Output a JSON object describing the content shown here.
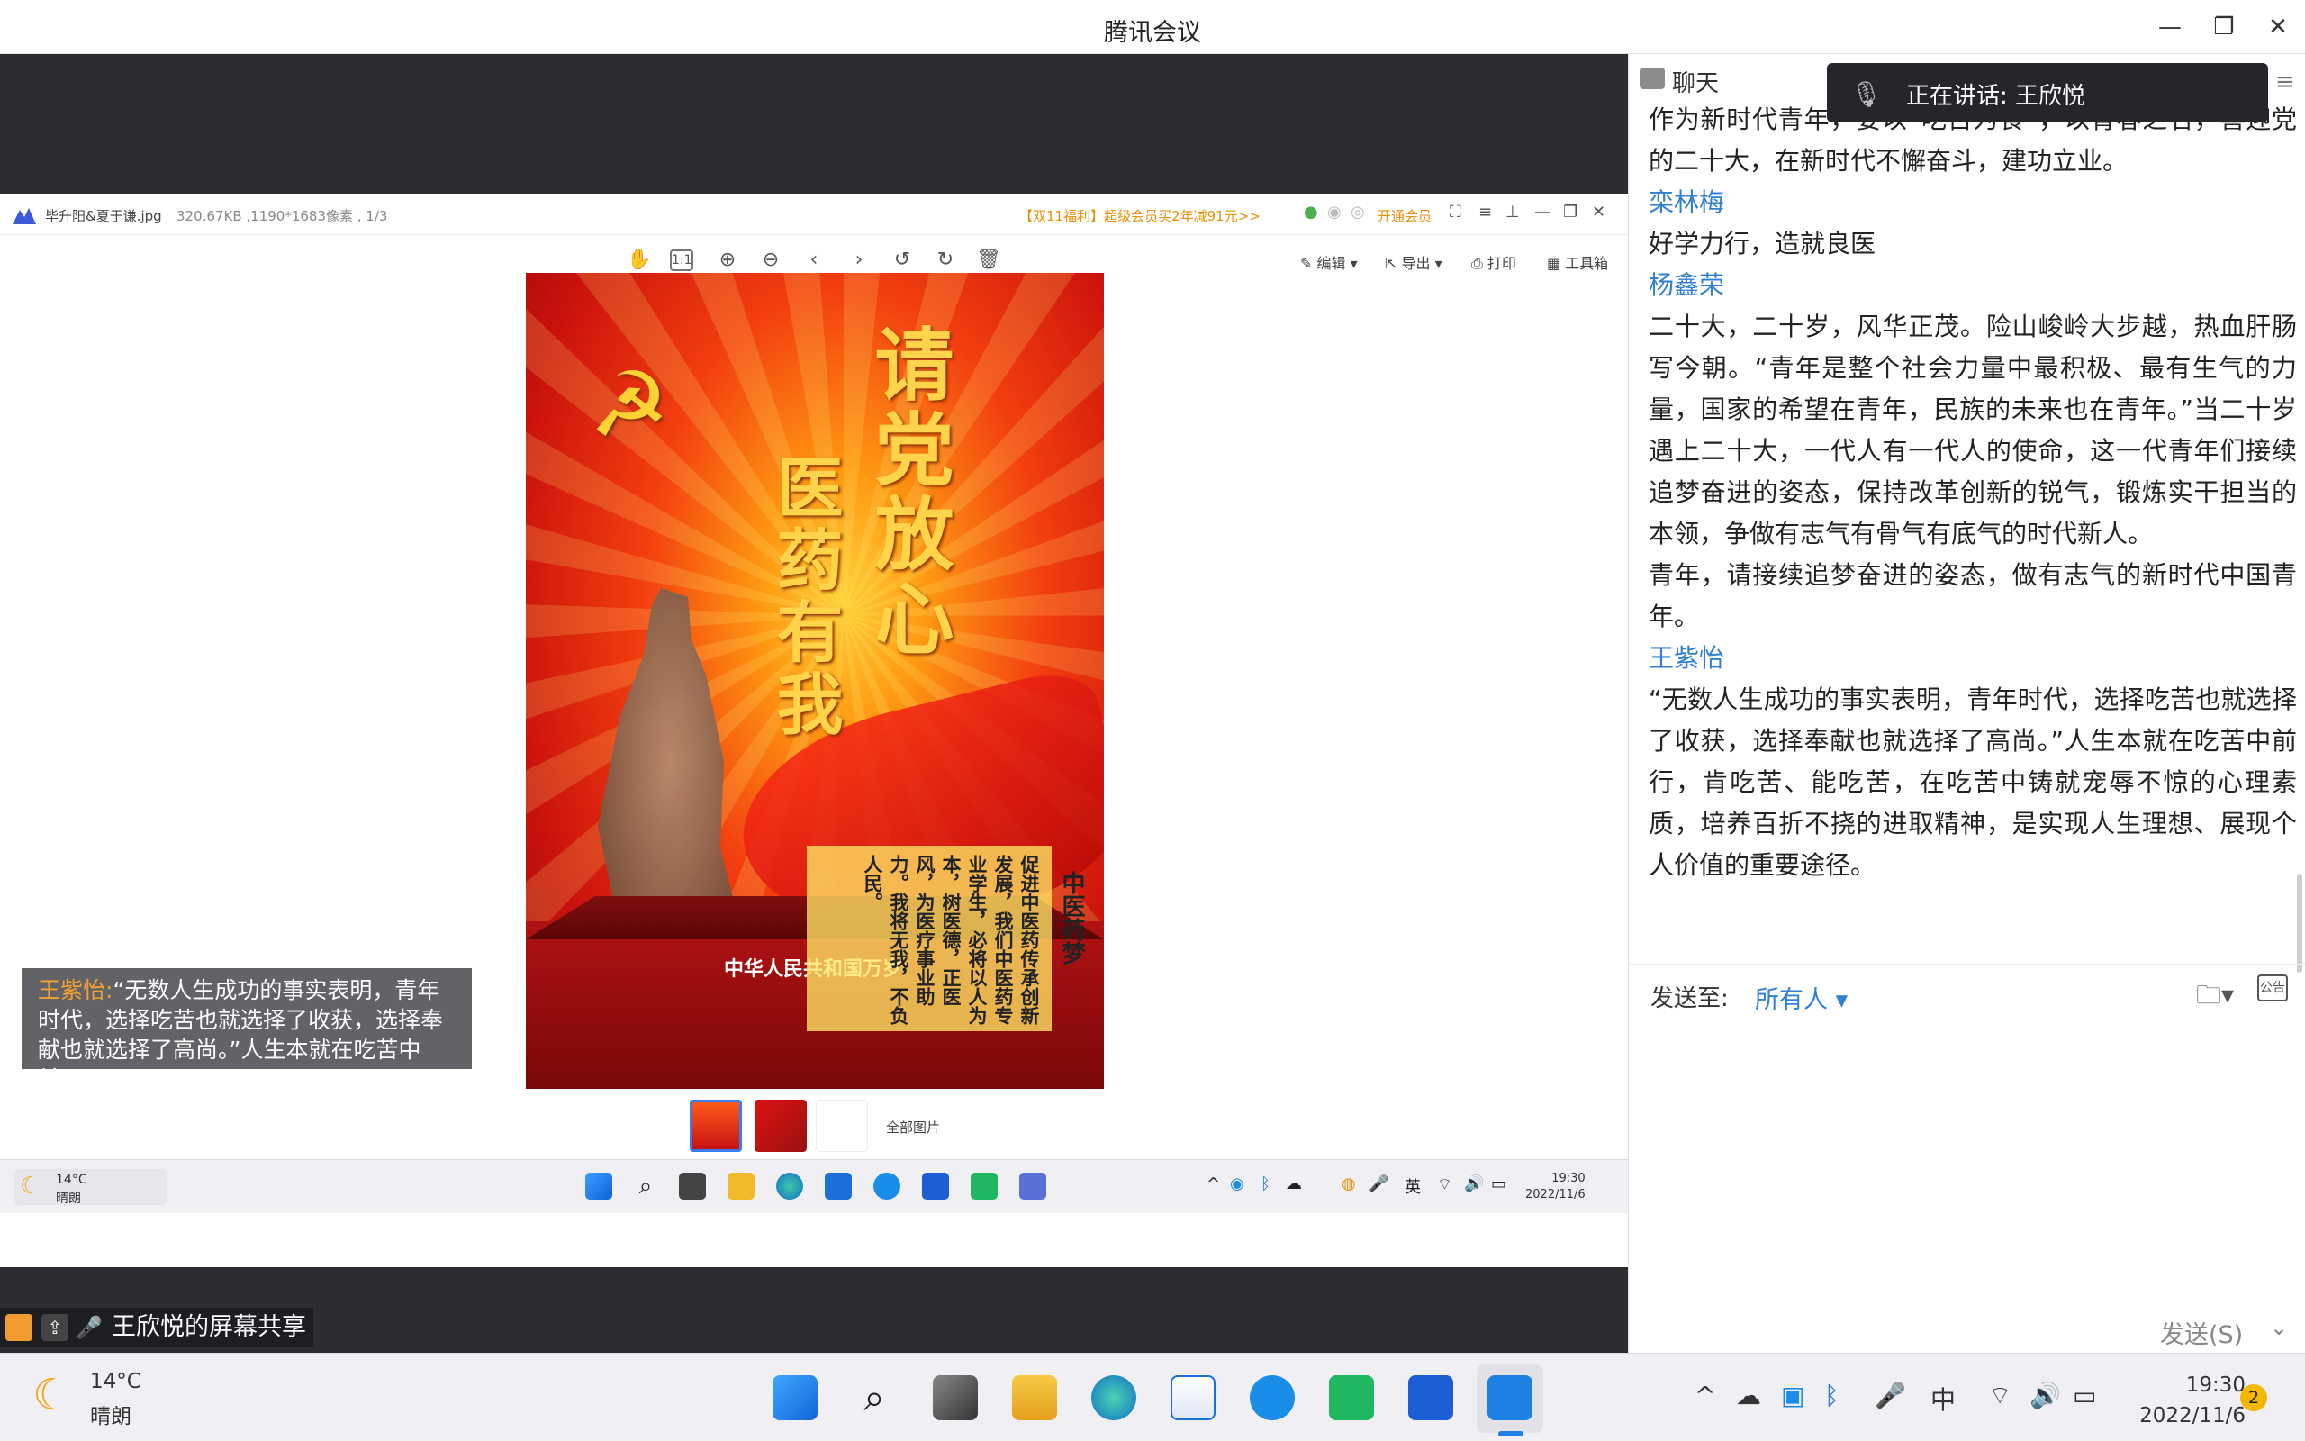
{
  "app": {
    "title": "腾讯会议"
  },
  "viewer": {
    "filename": "毕升阳&夏于谦.jpg",
    "meta": "320.67KB ,1190*1683像素 , 1/3",
    "promo": "【双11福利】超级会员买2年减91元>>",
    "vip": "开通会员",
    "tools_right": {
      "edit": "编辑",
      "export": "导出",
      "print": "打印",
      "toolbox": "工具箱"
    },
    "all_images": "全部图片"
  },
  "poster": {
    "slogan_right": "请党放心",
    "slogan_left": "医药有我",
    "box_title": "中医药梦",
    "box_text": "促进中医药传承创新发展，我们中医药专业学生，必将以人为本，树医德，正医风，为医疗事业助力。我将无我，不负人民。",
    "gate_text": "中华人民共和国万岁"
  },
  "remote_taskbar": {
    "temp": "14°C",
    "condition": "晴朗",
    "ime": "英",
    "time": "19:30",
    "date": "2022/11/6"
  },
  "caption": {
    "speaker": "王紫怡:",
    "text": "“无数人生成功的事实表明，青年时代，选择吃苦也就选择了收获，选择奉献也就选择了高尚。”人生本就在吃苦中前..."
  },
  "sharing_label": "王欣悦的屏幕共享",
  "chat": {
    "title": "聊天",
    "talking": "正在讲话: 王欣悦",
    "messages": [
      {
        "name": "",
        "text": "作为新时代青年，要以“吃苦为食”，以青春之名，喜迎党的二十大，在新时代不懈奋斗，建功立业。"
      },
      {
        "name": "栾林梅",
        "text": "好学力行，造就良医"
      },
      {
        "name": "杨鑫荣",
        "text": "二十大，二十岁，风华正茂。险山峻岭大步越，热血肝肠写今朝。“青年是整个社会力量中最积极、最有生气的力量，国家的希望在青年，民族的未来也在青年。”当二十岁遇上二十大，一代人有一代人的使命，这一代青年们接续追梦奋进的姿态，保持改革创新的锐气，锻炼实干担当的本领，争做有志气有骨气有底气的时代新人。"
      },
      {
        "name": "",
        "text": "青年，请接续追梦奋进的姿态，做有志气的新时代中国青年。"
      },
      {
        "name": "王紫怡",
        "text": "“无数人生成功的事实表明，青年时代，选择吃苦也就选择了收获，选择奉献也就选择了高尚。”人生本就在吃苦中前行，肯吃苦、能吃苦，在吃苦中铸就宠辱不惊的心理素质，培养百折不挠的进取精神，是实现人生理想、展现个人价值的重要途径。"
      }
    ],
    "send_to_label": "发送至:",
    "send_to_target": "所有人",
    "notice_icon_label": "公告",
    "send_button": "发送(S)"
  },
  "taskbar": {
    "temp": "14°C",
    "condition": "晴朗",
    "ime": "中",
    "time": "19:30",
    "date": "2022/11/6",
    "notifications": "2"
  },
  "colors": {
    "accent": "#2f7fd4",
    "promo": "#e8900a",
    "caption_speaker": "#f2a034"
  }
}
